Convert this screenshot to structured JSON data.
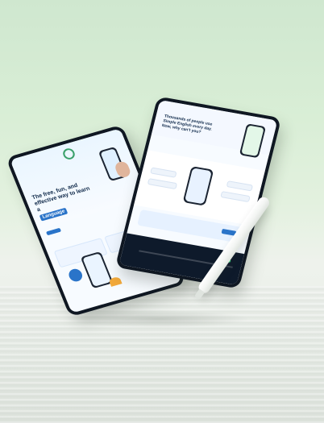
{
  "scene": {
    "description": "Two tablets displaying a language-learning landing page, floating over a light surface with a stylus.",
    "colors": {
      "background_top": "#cfe7cf",
      "background_bottom": "#e6ebe5",
      "tablet_frame": "#0f1722",
      "accent_blue": "#2a74c9",
      "accent_green": "#3aa06a",
      "accent_orange": "#f2a93b"
    }
  },
  "tablet_left": {
    "hero": {
      "title": "The free, fun, and effective way to learn a",
      "highlight": "Language"
    }
  },
  "tablet_right": {
    "top": {
      "title": "Thousands of people use Simple English every day. Now, why can't you?"
    }
  }
}
